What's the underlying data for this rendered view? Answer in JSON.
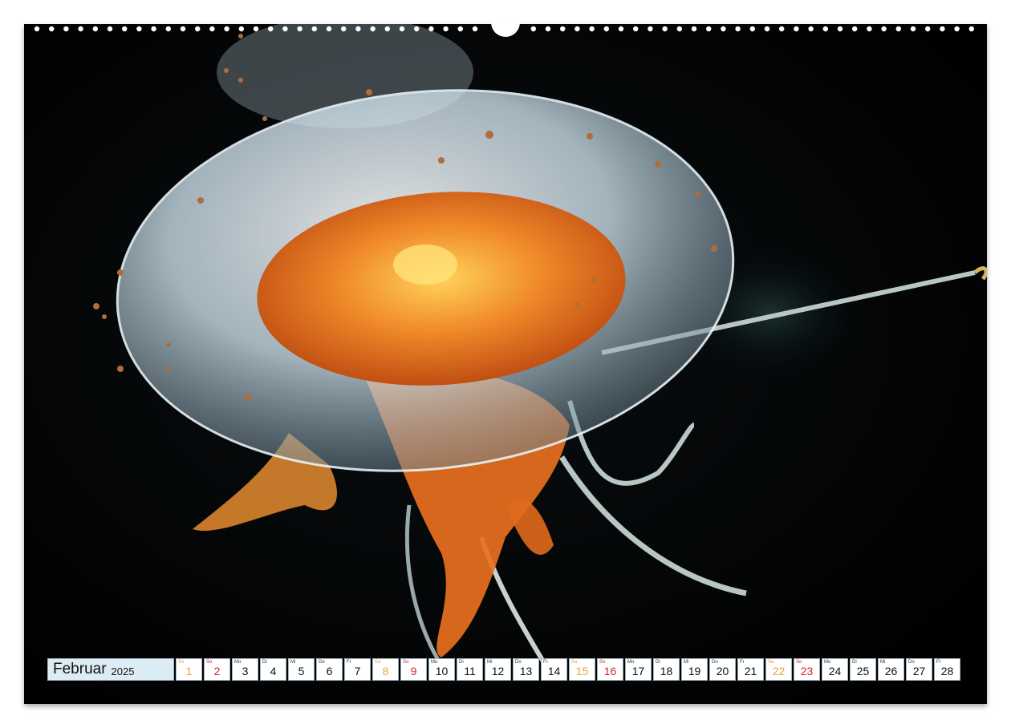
{
  "calendar": {
    "month": "Februar",
    "year": "2025",
    "days": [
      {
        "abbr": "Sa",
        "num": "1",
        "kind": "sat"
      },
      {
        "abbr": "So",
        "num": "2",
        "kind": "sun"
      },
      {
        "abbr": "Mo",
        "num": "3",
        "kind": "wd"
      },
      {
        "abbr": "Di",
        "num": "4",
        "kind": "wd"
      },
      {
        "abbr": "Mi",
        "num": "5",
        "kind": "wd"
      },
      {
        "abbr": "Do",
        "num": "6",
        "kind": "wd"
      },
      {
        "abbr": "Fr",
        "num": "7",
        "kind": "wd"
      },
      {
        "abbr": "Sa",
        "num": "8",
        "kind": "sat"
      },
      {
        "abbr": "So",
        "num": "9",
        "kind": "sun"
      },
      {
        "abbr": "Mo",
        "num": "10",
        "kind": "wd"
      },
      {
        "abbr": "Di",
        "num": "11",
        "kind": "wd"
      },
      {
        "abbr": "Mi",
        "num": "12",
        "kind": "wd"
      },
      {
        "abbr": "Do",
        "num": "13",
        "kind": "wd"
      },
      {
        "abbr": "Fr",
        "num": "14",
        "kind": "wd"
      },
      {
        "abbr": "Sa",
        "num": "15",
        "kind": "sat"
      },
      {
        "abbr": "So",
        "num": "16",
        "kind": "sun"
      },
      {
        "abbr": "Mo",
        "num": "17",
        "kind": "wd"
      },
      {
        "abbr": "Di",
        "num": "18",
        "kind": "wd"
      },
      {
        "abbr": "Mi",
        "num": "19",
        "kind": "wd"
      },
      {
        "abbr": "Do",
        "num": "20",
        "kind": "wd"
      },
      {
        "abbr": "Fr",
        "num": "21",
        "kind": "wd"
      },
      {
        "abbr": "Sa",
        "num": "22",
        "kind": "sat"
      },
      {
        "abbr": "So",
        "num": "23",
        "kind": "sun"
      },
      {
        "abbr": "Mo",
        "num": "24",
        "kind": "wd"
      },
      {
        "abbr": "Di",
        "num": "25",
        "kind": "wd"
      },
      {
        "abbr": "Mi",
        "num": "26",
        "kind": "wd"
      },
      {
        "abbr": "Do",
        "num": "27",
        "kind": "wd"
      },
      {
        "abbr": "Fr",
        "num": "28",
        "kind": "wd"
      }
    ]
  },
  "colors": {
    "background": "#000000",
    "bell_orange": "#e8701e",
    "bell_glass": "#cfe3ee",
    "saturday": "#e8a23a",
    "sunday": "#d2232a",
    "month_cell": "#dcecf4"
  },
  "image": {
    "subject": "jellyfish-photo"
  }
}
